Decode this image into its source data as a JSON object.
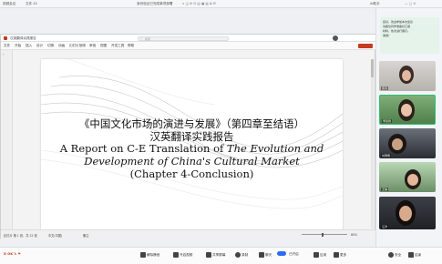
{
  "topbar": {
    "left_label": "视频会议",
    "left_sub": "文件 42",
    "center_label": "身份验证已完成事项部署",
    "right_label": "AI助手"
  },
  "ppt": {
    "tab_label": "汉英翻译实践报告",
    "menu": [
      "文件",
      "开始",
      "插入",
      "设计",
      "切换",
      "动画",
      "幻灯片放映",
      "审阅",
      "视图",
      "开发工具",
      "帮助"
    ],
    "search_placeholder": "搜索",
    "status_left": "幻灯片 第 1 张，共 12 张",
    "status_lang": "中文(中国)",
    "status_notes": "备注",
    "zoom": "80%"
  },
  "slide": {
    "line1": "《中国文化市场的演进与发展》（第四章至结语）",
    "line2": "汉英翻译实践报告",
    "line3_a": "A Report on C-E Translation of ",
    "line3_b": "The Evolution and",
    "line4": "Development of China's Cultural Market",
    "line5": "(Chapter 4-Conclusion)"
  },
  "sidebar": {
    "chat_lines": [
      "您好，欢迎参加本次会议",
      "请各位同学准备好汇报",
      "材料，依次进行展示。",
      "谢谢！"
    ],
    "participants": [
      {
        "name": "唐诗"
      },
      {
        "name": "李思雨"
      },
      {
        "name": "刘明明"
      },
      {
        "name": "王静"
      },
      {
        "name": "汪洋"
      }
    ]
  },
  "bottombar": {
    "mic": "解除静音",
    "video": "开启视频",
    "share": "共享屏幕",
    "record": "录制",
    "chat": "聊天",
    "status": "已开启",
    "apps": "应用",
    "more": "更多",
    "security": "安全",
    "end": "结束"
  },
  "colors": {
    "accent": "#c43b1d",
    "brand": "#2a6df4",
    "status": "#17b26a"
  }
}
